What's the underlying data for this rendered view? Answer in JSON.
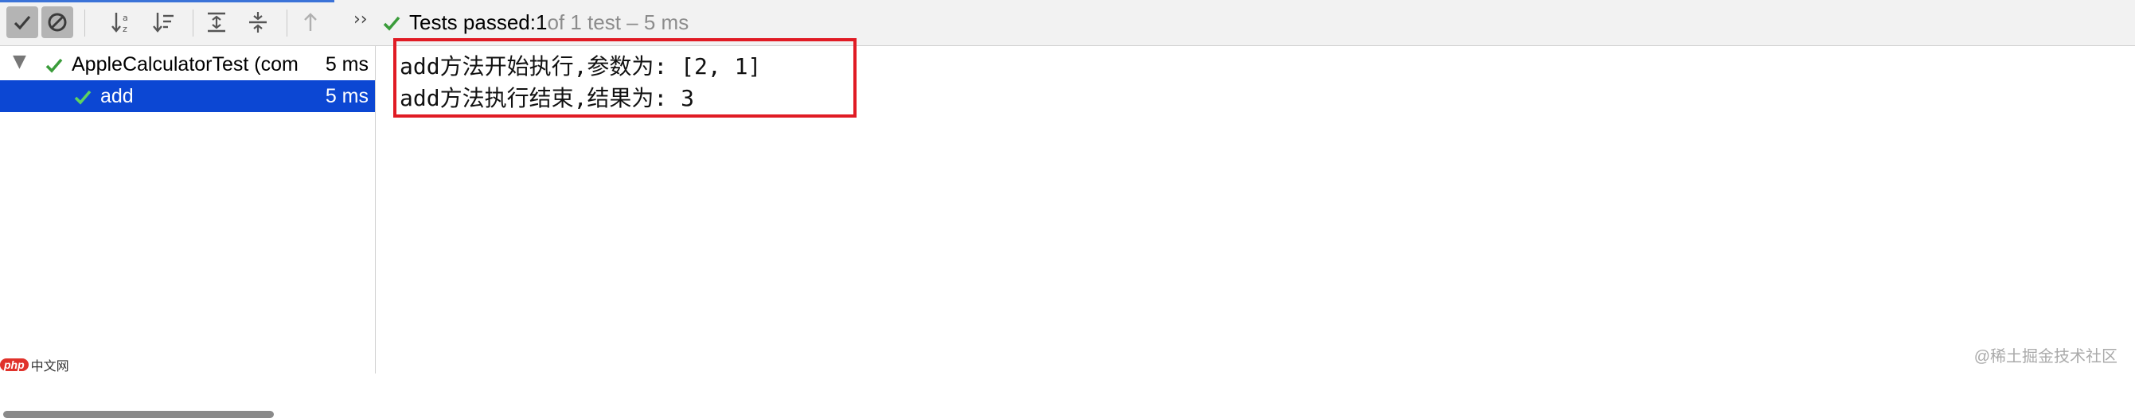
{
  "toolbar": {
    "buttons": [
      {
        "name": "show-passed",
        "icon": "check-icon"
      },
      {
        "name": "show-ignored",
        "icon": "no-entry-icon"
      },
      {
        "name": "sort-alphabetically",
        "icon": "sort-alpha-icon"
      },
      {
        "name": "sort-by-duration",
        "icon": "sort-duration-icon"
      },
      {
        "name": "expand-all",
        "icon": "expand-all-icon"
      },
      {
        "name": "collapse-all",
        "icon": "collapse-all-icon"
      },
      {
        "name": "previous-failed",
        "icon": "arrow-up-icon"
      }
    ],
    "more": "››",
    "status": {
      "prefix": "Tests passed: ",
      "count": "1",
      "rest": " of 1 test – 5 ms"
    }
  },
  "tree": [
    {
      "label": "AppleCalculatorTest (com",
      "time": "5 ms",
      "state": "passed",
      "expanded": true
    },
    {
      "label": "add",
      "time": "5 ms",
      "state": "passed",
      "selected": true
    }
  ],
  "console": {
    "lines": [
      "add方法开始执行,参数为: [2, 1]",
      "add方法执行结束,结果为: 3"
    ]
  },
  "watermarks": {
    "left_logo": "php",
    "left_text": "中文网",
    "right": "@稀土掘金技术社区"
  },
  "colors": {
    "selection": "#0c47d3",
    "pass_green": "#3a9c3a",
    "highlight_box": "#e01b24"
  }
}
